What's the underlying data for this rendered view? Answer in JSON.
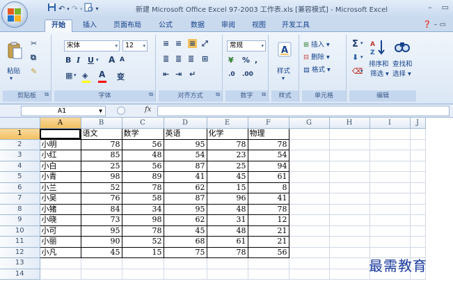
{
  "titlebar": {
    "title": "新建 Microsoft Office Excel 97-2003 工作表.xls  [兼容模式] - Microsoft Excel",
    "qat_save_icon": "save-icon",
    "qat_undo_icon": "undo-icon",
    "qat_redo_icon": "redo-icon",
    "qat_preview_icon": "print-preview-icon",
    "minimize": "–",
    "maximize": "▭"
  },
  "tabs": [
    "开始",
    "插入",
    "页面布局",
    "公式",
    "数据",
    "审阅",
    "视图",
    "开发工具"
  ],
  "active_tab": "开始",
  "ribbon": {
    "clipboard": {
      "label": "剪贴板",
      "paste": "粘贴"
    },
    "font": {
      "label": "字体",
      "name": "宋体",
      "size": "12",
      "bold": "B",
      "italic": "I",
      "underline": "U",
      "grow": "A",
      "shrink": "A",
      "phonetic": "变"
    },
    "alignment": {
      "label": "对齐方式"
    },
    "number": {
      "label": "数字",
      "format": "常规",
      "percent": "%",
      "comma": ","
    },
    "styles": {
      "label": "样式",
      "button": "样式"
    },
    "cells": {
      "label": "单元格",
      "insert": "插入",
      "delete": "删除",
      "format": "格式"
    },
    "editing": {
      "label": "编辑",
      "sort": "排序和",
      "filter": "筛选",
      "find": "查找和",
      "select": "选择"
    }
  },
  "formula_bar": {
    "name_box": "A1",
    "fx": "fx",
    "formula": ""
  },
  "sheet": {
    "columns": [
      "A",
      "B",
      "C",
      "D",
      "E",
      "F",
      "G",
      "H",
      "I",
      "J"
    ],
    "header_row": [
      "",
      "语文",
      "数学",
      "英语",
      "化学",
      "物理"
    ],
    "rows": [
      {
        "name": "小明",
        "values": [
          78,
          56,
          95,
          78,
          78
        ]
      },
      {
        "name": "小红",
        "values": [
          85,
          48,
          54,
          23,
          54
        ]
      },
      {
        "name": "小白",
        "values": [
          25,
          56,
          87,
          25,
          94
        ]
      },
      {
        "name": "小青",
        "values": [
          98,
          89,
          41,
          45,
          61
        ]
      },
      {
        "name": "小兰",
        "values": [
          52,
          78,
          62,
          15,
          8
        ]
      },
      {
        "name": "小吴",
        "values": [
          76,
          58,
          87,
          96,
          41
        ]
      },
      {
        "name": "小猪",
        "values": [
          84,
          34,
          95,
          48,
          78
        ]
      },
      {
        "name": "小晓",
        "values": [
          73,
          98,
          62,
          31,
          12
        ]
      },
      {
        "name": "小可",
        "values": [
          95,
          78,
          45,
          48,
          21
        ]
      },
      {
        "name": "小丽",
        "values": [
          90,
          52,
          68,
          61,
          21
        ]
      },
      {
        "name": "小凡",
        "values": [
          45,
          15,
          75,
          78,
          56
        ]
      }
    ],
    "extra_rows": [
      "13",
      "14"
    ]
  },
  "watermark": "最需教育",
  "colors": {
    "ribbon_blue": "#dbe7f5",
    "selection_orange": "#f1c15f",
    "font_color_red": "#ff0000",
    "highlight_yellow": "#ffff00"
  }
}
